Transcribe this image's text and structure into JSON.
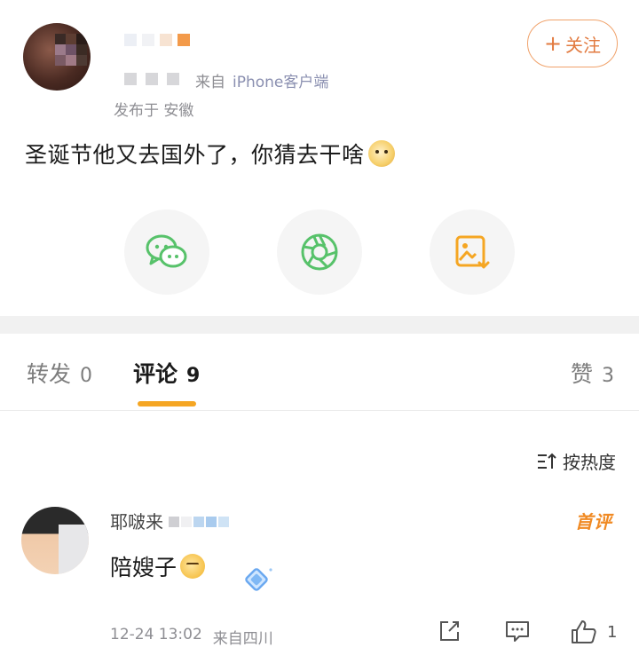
{
  "post": {
    "source_prefix": "来自",
    "source": "iPhone客户端",
    "location": "发布于 安徽",
    "text": "圣诞节他又去国外了，你猜去干啥",
    "follow_label": "关注",
    "follow_plus": "+"
  },
  "share_icons": [
    "wechat-icon",
    "moments-icon",
    "save-image-icon"
  ],
  "tabs": {
    "repost": {
      "label": "转发",
      "count": "0"
    },
    "comment": {
      "label": "评论",
      "count": "9"
    },
    "like": {
      "label": "赞",
      "count": "3"
    }
  },
  "sort": {
    "label": "按热度"
  },
  "comment": {
    "username": "耶啵来",
    "badge": "首评",
    "text": "陪嫂子",
    "time": "12-24 13:02",
    "location": "来自四川",
    "like_count": "1"
  },
  "colors": {
    "accent": "#f5a623",
    "follow": "#e27a3f",
    "wechat_green": "#57c26a"
  }
}
